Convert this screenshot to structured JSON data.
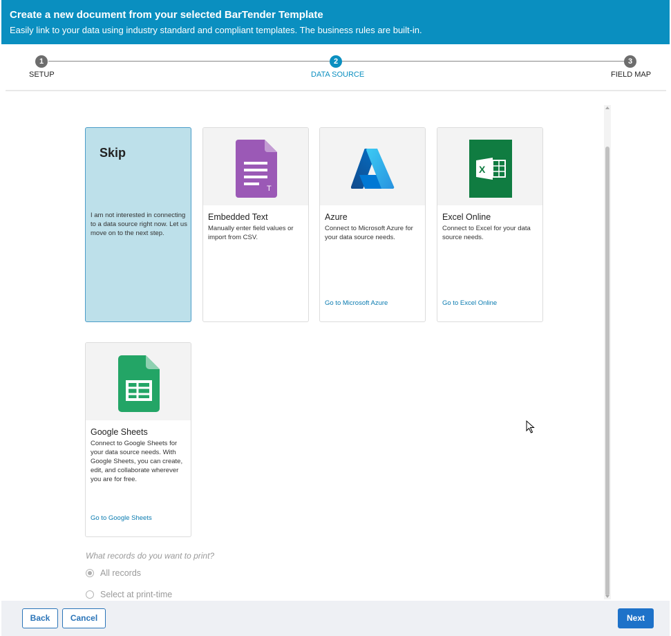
{
  "header": {
    "title": "Create a new document from your selected BarTender Template",
    "subtitle": "Easily link to your data using industry standard and compliant templates. The business rules are built-in."
  },
  "stepper": {
    "steps": [
      {
        "number": "1",
        "label": "SETUP"
      },
      {
        "number": "2",
        "label": "DATA SOURCE"
      },
      {
        "number": "3",
        "label": "FIELD MAP"
      }
    ],
    "active_step": "DATA SOURCE"
  },
  "cards": {
    "skip": {
      "title": "Skip",
      "description": "I am not interested in connecting to a data source right now. Let us move on to the next step."
    },
    "embedded_text": {
      "title": "Embedded Text",
      "description": "Manually enter field values or import from CSV.",
      "icon": "document-text-icon"
    },
    "azure": {
      "title": "Azure",
      "description": "Connect to Microsoft Azure for your data source needs.",
      "link": "Go to Microsoft Azure",
      "icon": "azure-logo-icon"
    },
    "excel_online": {
      "title": "Excel Online",
      "description": "Connect to Excel for your data source needs.",
      "link": "Go to Excel Online",
      "icon": "excel-logo-icon"
    },
    "google_sheets": {
      "title": "Google Sheets",
      "description": "Connect to Google Sheets for your data source needs. With Google Sheets, you can create, edit, and collaborate wherever you are for free.",
      "link": "Go to Google Sheets",
      "icon": "google-sheets-icon"
    }
  },
  "records": {
    "question": "What records do you want to print?",
    "options": [
      {
        "label": "All records",
        "checked": true
      },
      {
        "label": "Select at print-time",
        "checked": false
      }
    ]
  },
  "footer": {
    "back_label": "Back",
    "cancel_label": "Cancel",
    "next_label": "Next"
  },
  "colors": {
    "accent": "#0a8fc0",
    "skip_bg": "#bde0ea",
    "link": "#0a7bb0",
    "primary_button": "#1e72c9"
  }
}
